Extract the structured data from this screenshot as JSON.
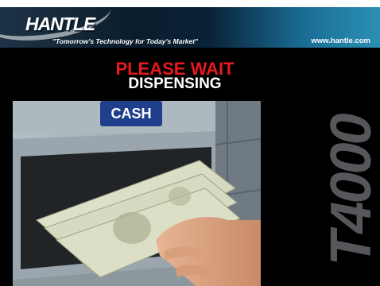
{
  "header": {
    "brand": "HANTLE",
    "tagline": "\"Tomorrow's Technology for Today's Market\"",
    "website": "www.hantle.com"
  },
  "screen": {
    "status_primary": "PLEASE WAIT",
    "status_secondary": "DISPENSING",
    "model": "T4000"
  },
  "photo": {
    "slot_label": "CASH",
    "subject": "atm-cash-dispensing-photo"
  },
  "colors": {
    "status_primary": "#e8191b",
    "status_secondary": "#ffffff",
    "background": "#000000",
    "model_text": "#55575a"
  }
}
